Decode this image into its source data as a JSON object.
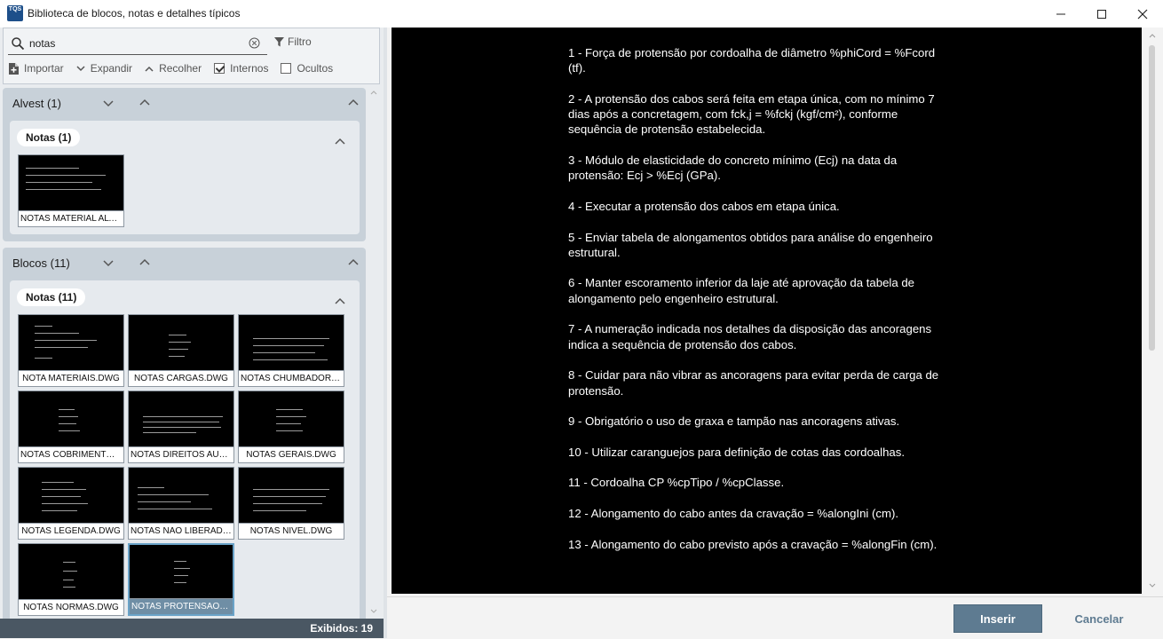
{
  "window": {
    "app_icon_label": "TQS",
    "title": "Biblioteca de blocos, notas e detalhes típicos"
  },
  "toolbar": {
    "search_value": "notas",
    "filter_label": "Filtro",
    "import_label": "Importar",
    "expand_label": "Expandir",
    "collapse_label": "Recolher",
    "internal_label": "Internos",
    "internal_checked": true,
    "hidden_label": "Ocultos",
    "hidden_checked": false
  },
  "groups": [
    {
      "title": "Alvest (1)",
      "subgroups": [
        {
          "title": "Notas (1)",
          "items": [
            {
              "label": "NOTAS MATERIAL ALVE...",
              "selected": false
            }
          ]
        }
      ]
    },
    {
      "title": "Blocos (11)",
      "subgroups": [
        {
          "title": "Notas (11)",
          "items": [
            {
              "label": "NOTA MATERIAIS.DWG",
              "selected": false
            },
            {
              "label": "NOTAS CARGAS.DWG",
              "selected": false
            },
            {
              "label": "NOTAS CHUMBADOR.D...",
              "selected": false
            },
            {
              "label": "NOTAS COBRIMENTO.D...",
              "selected": false
            },
            {
              "label": "NOTAS DIREITOS AUTO...",
              "selected": false
            },
            {
              "label": "NOTAS GERAIS.DWG",
              "selected": false
            },
            {
              "label": "NOTAS LEGENDA.DWG",
              "selected": false
            },
            {
              "label": "NOTAS NAO LIBERADA...",
              "selected": false
            },
            {
              "label": "NOTAS NIVEL.DWG",
              "selected": false
            },
            {
              "label": "NOTAS NORMAS.DWG",
              "selected": false
            },
            {
              "label": "NOTAS PROTENSAO.D...",
              "selected": true
            }
          ]
        }
      ]
    }
  ],
  "status": {
    "shown": "Exibidos: 19"
  },
  "preview": {
    "notes": [
      "1 - Força de protensão por cordoalha de diâmetro %phiCord = %Fcord (tf).",
      "2 - A protensão dos cabos será feita em etapa única, com no mínimo 7 dias após a concretagem, com fck,j = %fckj (kgf/cm²), conforme sequência de protensão estabelecida.",
      "3 - Módulo de elasticidade do concreto mínimo (Ecj) na data da protensão: Ecj > %Ecj (GPa).",
      "4 - Executar a protensão dos cabos em etapa única.",
      "5 - Enviar tabela de alongamentos obtidos para análise do engenheiro estrutural.",
      "6 - Manter escoramento inferior da laje até aprovação da tabela de alongamento pelo engenheiro estrutural.",
      "7 - A numeração indicada nos detalhes da disposição das ancoragens indica a sequência de protensão dos cabos.",
      "8 - Cuidar para não vibrar as ancoragens para evitar perda de carga de protensão.",
      "9 - Obrigatório o uso de graxa e tampão nas ancoragens ativas.",
      "10 - Utilizar caranguejos para definição de cotas das cordoalhas.",
      "11 - Cordoalha CP %cpTipo / %cpClasse.",
      "12 - Alongamento do cabo antes da cravação = %alongIni (cm).",
      "13 - Alongamento do cabo previsto após a cravação = %alongFin (cm)."
    ]
  },
  "buttons": {
    "insert": "Inserir",
    "cancel": "Cancelar"
  }
}
